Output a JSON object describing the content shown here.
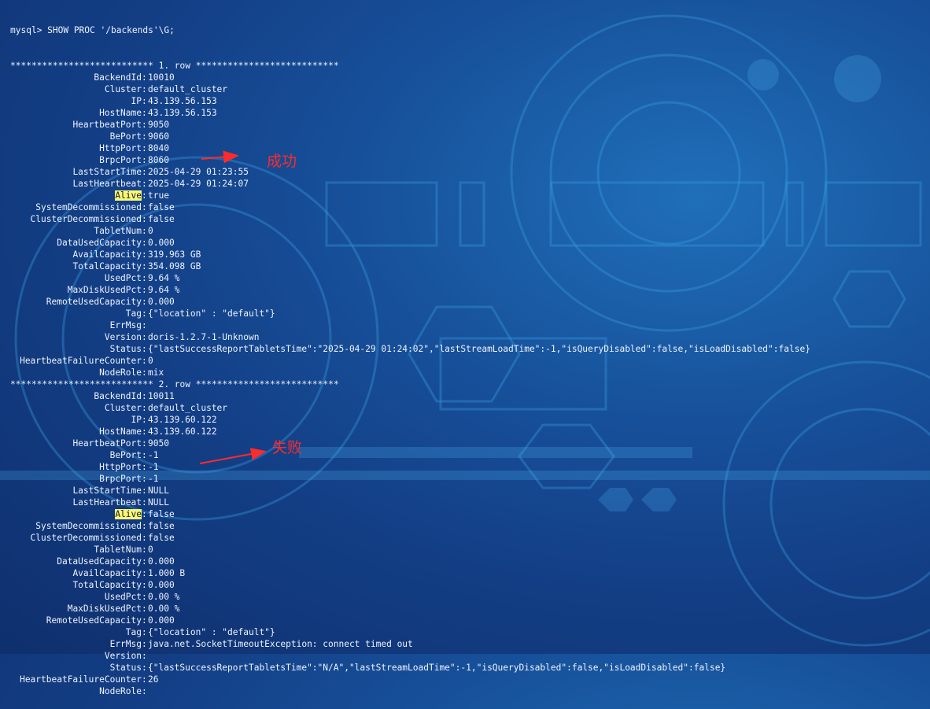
{
  "terminal": {
    "prompt": "mysql> SHOW PROC '/backends'\\G;",
    "rows": [
      {
        "header": "*************************** 1. row ***************************",
        "fields": [
          {
            "key": "BackendId",
            "value": "10010"
          },
          {
            "key": "Cluster",
            "value": "default_cluster"
          },
          {
            "key": "IP",
            "value": "43.139.56.153"
          },
          {
            "key": "HostName",
            "value": "43.139.56.153"
          },
          {
            "key": "HeartbeatPort",
            "value": "9050"
          },
          {
            "key": "BePort",
            "value": "9060"
          },
          {
            "key": "HttpPort",
            "value": "8040"
          },
          {
            "key": "BrpcPort",
            "value": "8060"
          },
          {
            "key": "LastStartTime",
            "value": "2025-04-29 01:23:55"
          },
          {
            "key": "LastHeartbeat",
            "value": "2025-04-29 01:24:07"
          },
          {
            "key": "Alive",
            "value": "true",
            "highlight": true
          },
          {
            "key": "SystemDecommissioned",
            "value": "false"
          },
          {
            "key": "ClusterDecommissioned",
            "value": "false"
          },
          {
            "key": "TabletNum",
            "value": "0"
          },
          {
            "key": "DataUsedCapacity",
            "value": "0.000"
          },
          {
            "key": "AvailCapacity",
            "value": "319.963 GB"
          },
          {
            "key": "TotalCapacity",
            "value": "354.098 GB"
          },
          {
            "key": "UsedPct",
            "value": "9.64 %"
          },
          {
            "key": "MaxDiskUsedPct",
            "value": "9.64 %"
          },
          {
            "key": "RemoteUsedCapacity",
            "value": "0.000"
          },
          {
            "key": "Tag",
            "value": "{\"location\" : \"default\"}"
          },
          {
            "key": "ErrMsg",
            "value": ""
          },
          {
            "key": "Version",
            "value": "doris-1.2.7-1-Unknown"
          },
          {
            "key": "Status",
            "value": "{\"lastSuccessReportTabletsTime\":\"2025-04-29 01:24:02\",\"lastStreamLoadTime\":-1,\"isQueryDisabled\":false,\"isLoadDisabled\":false}"
          },
          {
            "key": "HeartbeatFailureCounter",
            "value": "0"
          },
          {
            "key": "NodeRole",
            "value": "mix"
          }
        ]
      },
      {
        "header": "*************************** 2. row ***************************",
        "fields": [
          {
            "key": "BackendId",
            "value": "10011"
          },
          {
            "key": "Cluster",
            "value": "default_cluster"
          },
          {
            "key": "IP",
            "value": "43.139.60.122"
          },
          {
            "key": "HostName",
            "value": "43.139.60.122"
          },
          {
            "key": "HeartbeatPort",
            "value": "9050"
          },
          {
            "key": "BePort",
            "value": "-1"
          },
          {
            "key": "HttpPort",
            "value": "-1"
          },
          {
            "key": "BrpcPort",
            "value": "-1"
          },
          {
            "key": "LastStartTime",
            "value": "NULL"
          },
          {
            "key": "LastHeartbeat",
            "value": "NULL"
          },
          {
            "key": "Alive",
            "value": "false",
            "highlight": true
          },
          {
            "key": "SystemDecommissioned",
            "value": "false"
          },
          {
            "key": "ClusterDecommissioned",
            "value": "false"
          },
          {
            "key": "TabletNum",
            "value": "0"
          },
          {
            "key": "DataUsedCapacity",
            "value": "0.000"
          },
          {
            "key": "AvailCapacity",
            "value": "1.000 B"
          },
          {
            "key": "TotalCapacity",
            "value": "0.000"
          },
          {
            "key": "UsedPct",
            "value": "0.00 %"
          },
          {
            "key": "MaxDiskUsedPct",
            "value": "0.00 %"
          },
          {
            "key": "RemoteUsedCapacity",
            "value": "0.000"
          },
          {
            "key": "Tag",
            "value": "{\"location\" : \"default\"}"
          },
          {
            "key": "ErrMsg",
            "value": "java.net.SocketTimeoutException: connect timed out"
          },
          {
            "key": "Version",
            "value": ""
          },
          {
            "key": "Status",
            "value": "{\"lastSuccessReportTabletsTime\":\"N/A\",\"lastStreamLoadTime\":-1,\"isQueryDisabled\":false,\"isLoadDisabled\":false}"
          },
          {
            "key": "HeartbeatFailureCounter",
            "value": "26"
          },
          {
            "key": "NodeRole",
            "value": ""
          }
        ]
      }
    ]
  },
  "annotations": {
    "success_label": "成功",
    "fail_label": "失败",
    "arrow_color": "#ff2a2a",
    "highlight_color": "#f7f77a"
  }
}
